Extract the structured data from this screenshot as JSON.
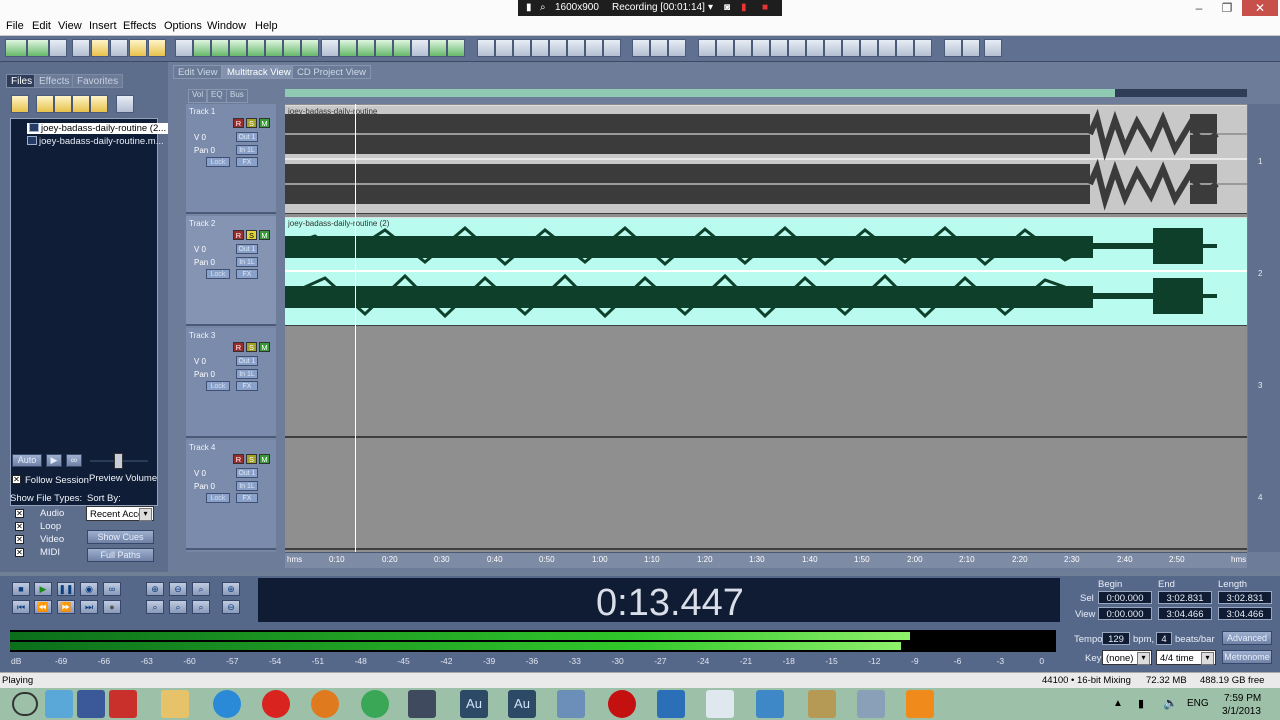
{
  "menubar": {
    "items": [
      "File",
      "Edit",
      "View",
      "Insert",
      "Effects",
      "Options",
      "Window",
      "Help"
    ]
  },
  "recorder": {
    "resolution": "1600x900",
    "status": "Recording [00:01:14]"
  },
  "left_panel": {
    "tabs": [
      "Files",
      "Effects",
      "Favorites"
    ],
    "files": [
      "joey-badass-daily-routine (2...",
      "joey-badass-daily-routine.m..."
    ],
    "auto_label": "Auto",
    "follow_session": "Follow Session",
    "preview_volume": "Preview Volume",
    "show_file_types": "Show File Types:",
    "sort_by": "Sort By:",
    "sort_value": "Recent Acce",
    "file_types": [
      "Audio",
      "Loop",
      "Video",
      "MIDI"
    ],
    "show_cues": "Show Cues",
    "full_paths": "Full Paths"
  },
  "view_tabs": [
    "Edit View",
    "Multitrack View",
    "CD Project View"
  ],
  "track_tabs": [
    "Vol",
    "EQ",
    "Bus"
  ],
  "tracks": [
    {
      "name": "Track 1",
      "vol": "V 0",
      "pan": "Pan 0",
      "out": "Out 1",
      "in": "In 1L",
      "lock": "Lock",
      "fx": "FX",
      "r": "R",
      "s": "S",
      "m": "M",
      "clip": "joey-badass-daily-routine",
      "num": "1"
    },
    {
      "name": "Track 2",
      "vol": "V 0",
      "pan": "Pan 0",
      "out": "Out 1",
      "in": "In 1L",
      "lock": "Lock",
      "fx": "FX",
      "r": "R",
      "s": "S",
      "m": "M",
      "clip": "joey-badass-daily-routine (2)",
      "num": "2"
    },
    {
      "name": "Track 3",
      "vol": "V 0",
      "pan": "Pan 0",
      "out": "Out 1",
      "in": "In 1L",
      "lock": "Lock",
      "fx": "FX",
      "r": "R",
      "s": "S",
      "m": "M",
      "clip": "",
      "num": "3"
    },
    {
      "name": "Track 4",
      "vol": "V 0",
      "pan": "Pan 0",
      "out": "Out 1",
      "in": "In 1L",
      "lock": "Lock",
      "fx": "FX",
      "r": "R",
      "s": "S",
      "m": "M",
      "clip": "",
      "num": "4"
    }
  ],
  "ruler": {
    "ticks": [
      "hms",
      "0:10",
      "0:20",
      "0:30",
      "0:40",
      "0:50",
      "1:00",
      "1:10",
      "1:20",
      "1:30",
      "1:40",
      "1:50",
      "2:00",
      "2:10",
      "2:20",
      "2:30",
      "2:40",
      "2:50",
      "hms"
    ]
  },
  "time": "0:13.447",
  "selection": {
    "headers": [
      "Begin",
      "End",
      "Length"
    ],
    "sel_label": "Sel",
    "view_label": "View",
    "sel": [
      "0:00.000",
      "3:02.831",
      "3:02.831"
    ],
    "view": [
      "0:00.000",
      "3:04.466",
      "3:04.466"
    ]
  },
  "meter": {
    "db_labels": [
      "dB",
      "-69",
      "-66",
      "-63",
      "-60",
      "-57",
      "-54",
      "-51",
      "-48",
      "-45",
      "-42",
      "-39",
      "-36",
      "-33",
      "-30",
      "-27",
      "-24",
      "-21",
      "-18",
      "-15",
      "-12",
      "-9",
      "-6",
      "-3",
      "0"
    ],
    "level": 0.86
  },
  "tempo": {
    "label": "Tempo",
    "value": "129",
    "bpm": "bpm,",
    "beats": "4",
    "beats_label": "beats/bar",
    "advanced": "Advanced",
    "key_label": "Key",
    "key": "(none)",
    "time_sig": "4/4 time",
    "metronome": "Metronome"
  },
  "status": {
    "state": "Playing",
    "format": "44100 • 16-bit Mixing",
    "mem": "72.32 MB",
    "free": "488.19 GB free"
  },
  "taskbar": {
    "lang": "ENG",
    "time": "7:59 PM",
    "date": "3/1/2013",
    "au": "Au"
  },
  "colors": {
    "panel": "#5d6e8d",
    "selected_clip": "#b9fbee",
    "waveform_dark": "#3b3b3b",
    "waveform_green": "#0e3f2a",
    "meter_green": "#32d12a"
  }
}
